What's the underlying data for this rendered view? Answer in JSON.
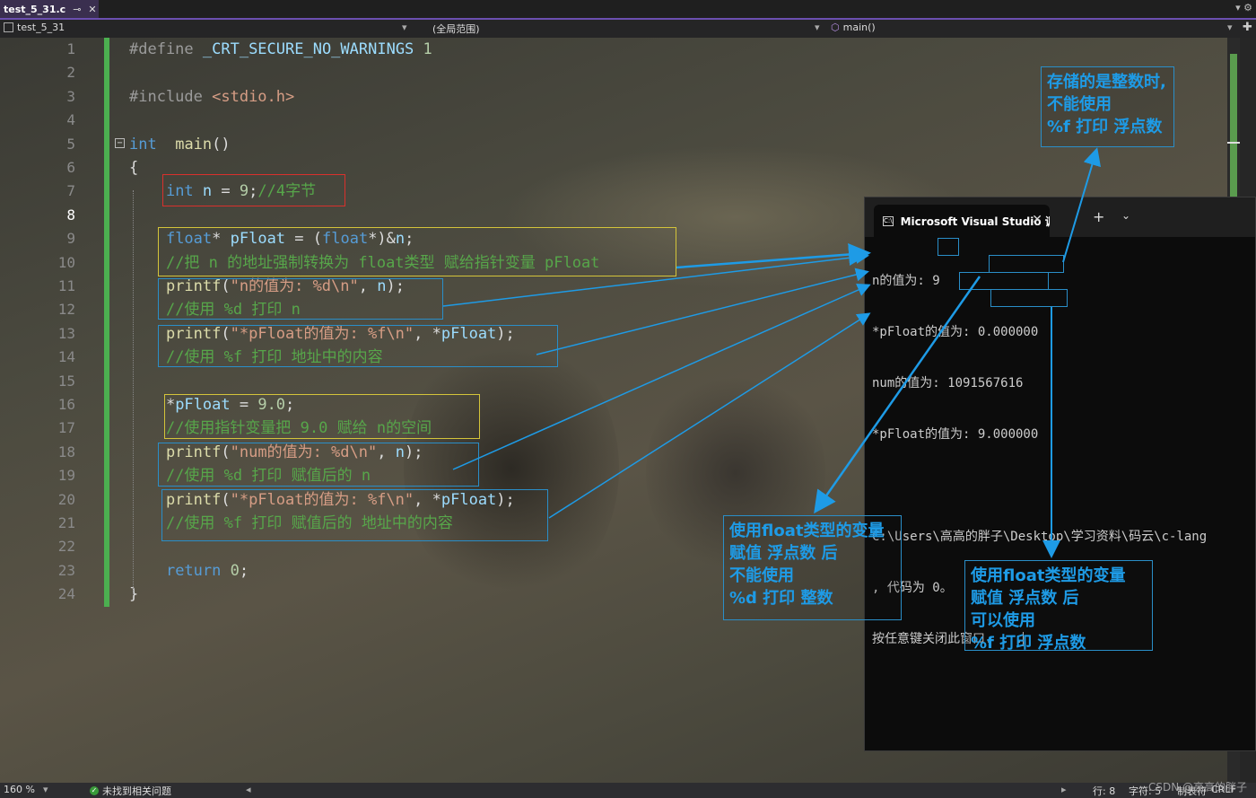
{
  "tab": {
    "title": "test_5_31.c",
    "pin": "⊸",
    "close": "✕",
    "right_glyphs": "▾ ⚙"
  },
  "navbar": {
    "project": "test_5_31",
    "scope": "(全局范围)",
    "function": "main()",
    "dropdown": "▾",
    "plus": "✚"
  },
  "code_lines": [
    {
      "n": "1",
      "segments": [
        [
          "pp",
          "#define "
        ],
        [
          "id",
          "_CRT_SECURE_NO_WARNINGS"
        ],
        [
          "pp",
          " "
        ],
        [
          "num",
          "1"
        ]
      ]
    },
    {
      "n": "2",
      "segments": []
    },
    {
      "n": "3",
      "segments": [
        [
          "pp",
          "#include "
        ],
        [
          "str",
          "<stdio.h>"
        ]
      ]
    },
    {
      "n": "4",
      "segments": []
    },
    {
      "n": "5",
      "segments": [
        [
          "kw",
          "int"
        ],
        [
          "",
          "  "
        ],
        [
          "fn",
          "main"
        ],
        [
          "",
          "()"
        ]
      ]
    },
    {
      "n": "6",
      "segments": [
        [
          "",
          "{"
        ]
      ]
    },
    {
      "n": "7",
      "segments": [
        [
          "",
          "    "
        ],
        [
          "kw",
          "int"
        ],
        [
          "",
          " "
        ],
        [
          "id",
          "n"
        ],
        [
          "",
          " = "
        ],
        [
          "num",
          "9"
        ],
        [
          "",
          ";"
        ],
        [
          "cm",
          "//4字节"
        ]
      ]
    },
    {
      "n": "8",
      "segments": []
    },
    {
      "n": "9",
      "segments": [
        [
          "",
          "    "
        ],
        [
          "kw",
          "float"
        ],
        [
          "",
          "* "
        ],
        [
          "id",
          "pFloat"
        ],
        [
          "",
          " = ("
        ],
        [
          "kw",
          "float"
        ],
        [
          "",
          "*)&"
        ],
        [
          "id",
          "n"
        ],
        [
          "",
          ";"
        ]
      ]
    },
    {
      "n": "10",
      "segments": [
        [
          "",
          "    "
        ],
        [
          "cm",
          "//把 n 的地址强制转换为 float类型 赋给指针变量 pFloat"
        ]
      ]
    },
    {
      "n": "11",
      "segments": [
        [
          "",
          "    "
        ],
        [
          "fn",
          "printf"
        ],
        [
          "",
          "("
        ],
        [
          "str",
          "\"n的值为: %d\\n\""
        ],
        [
          "",
          ", "
        ],
        [
          "id",
          "n"
        ],
        [
          "",
          ");"
        ]
      ]
    },
    {
      "n": "12",
      "segments": [
        [
          "",
          "    "
        ],
        [
          "cm",
          "//使用 %d 打印 n"
        ]
      ]
    },
    {
      "n": "13",
      "segments": [
        [
          "",
          "    "
        ],
        [
          "fn",
          "printf"
        ],
        [
          "",
          "("
        ],
        [
          "str",
          "\"*pFloat的值为: %f\\n\""
        ],
        [
          "",
          ", *"
        ],
        [
          "id",
          "pFloat"
        ],
        [
          "",
          ");"
        ]
      ]
    },
    {
      "n": "14",
      "segments": [
        [
          "",
          "    "
        ],
        [
          "cm",
          "//使用 %f 打印 地址中的内容"
        ]
      ]
    },
    {
      "n": "15",
      "segments": []
    },
    {
      "n": "16",
      "segments": [
        [
          "",
          "    *"
        ],
        [
          "id",
          "pFloat"
        ],
        [
          "",
          " = "
        ],
        [
          "num",
          "9.0"
        ],
        [
          "",
          ";"
        ]
      ]
    },
    {
      "n": "17",
      "segments": [
        [
          "",
          "    "
        ],
        [
          "cm",
          "//使用指针变量把 9.0 赋给 n的空间"
        ]
      ]
    },
    {
      "n": "18",
      "segments": [
        [
          "",
          "    "
        ],
        [
          "fn",
          "printf"
        ],
        [
          "",
          "("
        ],
        [
          "str",
          "\"num的值为: %d\\n\""
        ],
        [
          "",
          ", "
        ],
        [
          "id",
          "n"
        ],
        [
          "",
          ");"
        ]
      ]
    },
    {
      "n": "19",
      "segments": [
        [
          "",
          "    "
        ],
        [
          "cm",
          "//使用 %d 打印 赋值后的 n"
        ]
      ]
    },
    {
      "n": "20",
      "segments": [
        [
          "",
          "    "
        ],
        [
          "fn",
          "printf"
        ],
        [
          "",
          "("
        ],
        [
          "str",
          "\"*pFloat的值为: %f\\n\""
        ],
        [
          "",
          ", *"
        ],
        [
          "id",
          "pFloat"
        ],
        [
          "",
          ");"
        ]
      ]
    },
    {
      "n": "21",
      "segments": [
        [
          "",
          "    "
        ],
        [
          "cm",
          "//使用 %f 打印 赋值后的 地址中的内容"
        ]
      ]
    },
    {
      "n": "22",
      "segments": []
    },
    {
      "n": "23",
      "segments": [
        [
          "",
          "    "
        ],
        [
          "kw",
          "return"
        ],
        [
          "",
          " "
        ],
        [
          "num",
          "0"
        ],
        [
          "",
          ";"
        ]
      ]
    },
    {
      "n": "24",
      "segments": [
        [
          "",
          "}"
        ]
      ]
    }
  ],
  "current_line": "8",
  "console": {
    "title": "Microsoft Visual Studio 调试控",
    "close": "✕",
    "plus": "+",
    "down": "⌄",
    "lines": [
      "n的值为: 9",
      "*pFloat的值为: 0.000000",
      "num的值为: 1091567616",
      "*pFloat的值为: 9.000000",
      "",
      "C:\\Users\\高高的胖子\\Desktop\\学习资料\\码云\\c-lang",
      ", 代码为 0。",
      "按任意键关闭此窗口. . ."
    ]
  },
  "notes": {
    "top_right": "存储的是整数时,\n不能使用\n%f 打印 浮点数",
    "middle": "使用float类型的变量\n赋值 浮点数 后\n不能使用\n%d 打印 整数",
    "right": "使用float类型的变量\n赋值 浮点数 后\n可以使用\n%f 打印 浮点数"
  },
  "status": {
    "zoom": "160 %",
    "issues": "未找到相关问题",
    "line": "行: 8",
    "char": "字符: 5",
    "tabs": "制表符",
    "enc": "CRLF"
  },
  "watermark": "CSDN @高高的胖子",
  "colors": {
    "accent": "#6b4fb0",
    "annotation_blue": "#1e9be6",
    "green_bar": "#4caf50"
  }
}
